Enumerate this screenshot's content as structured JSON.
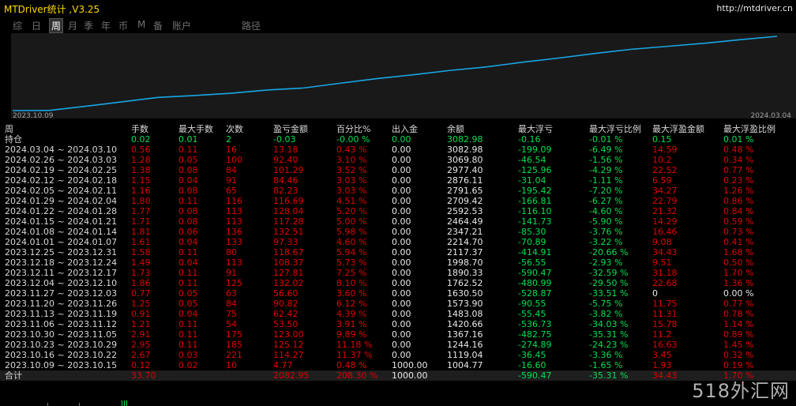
{
  "app": {
    "title": "MTDriver统计 ,V3.25",
    "url": "http://mtdriver.cn"
  },
  "tabs": [
    {
      "label": "综",
      "active": false
    },
    {
      "label": "日",
      "active": false
    },
    {
      "label": "周",
      "active": true
    },
    {
      "label": "月",
      "active": false
    },
    {
      "label": "季",
      "active": false
    },
    {
      "label": "年",
      "active": false
    },
    {
      "label": "币",
      "active": false
    },
    {
      "label": "M",
      "active": false
    },
    {
      "label": "备",
      "active": false
    },
    {
      "label": "账户",
      "active": false
    },
    {
      "label": "路径",
      "active": false
    }
  ],
  "chart_data": {
    "type": "line",
    "x_labels": [
      "2023.10.09",
      "2024.03.04"
    ],
    "x": [
      "2023.10.09",
      "2023.10.16",
      "2023.10.23",
      "2023.10.30",
      "2023.11.06",
      "2023.11.13",
      "2023.11.20",
      "2023.11.27",
      "2023.12.04",
      "2023.12.11",
      "2023.12.18",
      "2023.12.25",
      "2024.01.01",
      "2024.01.08",
      "2024.01.15",
      "2024.01.22",
      "2024.01.29",
      "2024.02.05",
      "2024.02.12",
      "2024.02.19",
      "2024.02.26",
      "2024.03.04"
    ],
    "values": [
      0,
      4.77,
      119.04,
      244.16,
      367.16,
      420.66,
      483.08,
      573.9,
      630.5,
      762.52,
      890.33,
      998.7,
      1117.37,
      1214.7,
      1347.21,
      1464.29,
      1592.53,
      1709.21,
      1791.65,
      1876.21,
      1977.4,
      2069.8
    ],
    "color": "#19a6e6"
  },
  "table": {
    "headers": [
      "周",
      "手数",
      "最大手数",
      "次数",
      "盈亏金额",
      "百分比%",
      "出入金",
      "余额",
      "最大浮亏",
      "最大浮亏比例",
      "最大浮盈金额",
      "最大浮盈比例"
    ],
    "holding": {
      "label": "持仓",
      "lots": "0.02",
      "max_lots": "0.01",
      "count": "2",
      "pnl": "-0.03",
      "pct": "-0.00 %",
      "io": "0.00",
      "balance": "3082.98",
      "max_dd": "-0.16",
      "max_dd_pct": "-0.01 %",
      "max_fp": "0.15",
      "max_fp_pct": "0.01 %"
    },
    "rows": [
      {
        "label": "2024.03.04 ~ 2024.03.10",
        "lots": "0.56",
        "max_lots": "0.11",
        "count": "16",
        "pnl": "13.18",
        "pct": "0.43 %",
        "io": "0.00",
        "balance": "3082.98",
        "max_dd": "-199.09",
        "max_dd_pct": "-6.49 %",
        "max_fp": "14.59",
        "max_fp_pct": "0.48 %"
      },
      {
        "label": "2024.02.26 ~ 2024.03.03",
        "lots": "1.28",
        "max_lots": "0.05",
        "count": "100",
        "pnl": "92.40",
        "pct": "3.10 %",
        "io": "0.00",
        "balance": "3069.80",
        "max_dd": "-46.54",
        "max_dd_pct": "-1.56 %",
        "max_fp": "10.2",
        "max_fp_pct": "0.34 %"
      },
      {
        "label": "2024.02.19 ~ 2024.02.25",
        "lots": "1.38",
        "max_lots": "0.08",
        "count": "84",
        "pnl": "101.29",
        "pct": "3.52 %",
        "io": "0.00",
        "balance": "2977.40",
        "max_dd": "-125.96",
        "max_dd_pct": "-4.29 %",
        "max_fp": "22.52",
        "max_fp_pct": "0.77 %"
      },
      {
        "label": "2024.02.12 ~ 2024.02.18",
        "lots": "1.15",
        "max_lots": "0.04",
        "count": "91",
        "pnl": "84.46",
        "pct": "3.03 %",
        "io": "0.00",
        "balance": "2876.11",
        "max_dd": "-31.04",
        "max_dd_pct": "-1.11 %",
        "max_fp": "6.59",
        "max_fp_pct": "0.23 %"
      },
      {
        "label": "2024.02.05 ~ 2024.02.11",
        "lots": "1.16",
        "max_lots": "0.08",
        "count": "65",
        "pnl": "82.23",
        "pct": "3.03 %",
        "io": "0.00",
        "balance": "2791.65",
        "max_dd": "-195.42",
        "max_dd_pct": "-7.20 %",
        "max_fp": "34.27",
        "max_fp_pct": "1.26 %"
      },
      {
        "label": "2024.01.29 ~ 2024.02.04",
        "lots": "1.80",
        "max_lots": "0.11",
        "count": "116",
        "pnl": "116.69",
        "pct": "4.51 %",
        "io": "0.00",
        "balance": "2709.42",
        "max_dd": "-166.81",
        "max_dd_pct": "-6.27 %",
        "max_fp": "22.79",
        "max_fp_pct": "0.86 %"
      },
      {
        "label": "2024.01.22 ~ 2024.01.28",
        "lots": "1.77",
        "max_lots": "0.08",
        "count": "113",
        "pnl": "128.04",
        "pct": "5.20 %",
        "io": "0.00",
        "balance": "2592.53",
        "max_dd": "-116.10",
        "max_dd_pct": "-4.60 %",
        "max_fp": "21.32",
        "max_fp_pct": "0.84 %"
      },
      {
        "label": "2024.01.15 ~ 2024.01.21",
        "lots": "1.71",
        "max_lots": "0.08",
        "count": "113",
        "pnl": "117.28",
        "pct": "5.00 %",
        "io": "0.00",
        "balance": "2464.49",
        "max_dd": "-141.73",
        "max_dd_pct": "-5.90 %",
        "max_fp": "14.29",
        "max_fp_pct": "0.59 %"
      },
      {
        "label": "2024.01.08 ~ 2024.01.14",
        "lots": "1.81",
        "max_lots": "0.06",
        "count": "136",
        "pnl": "132.51",
        "pct": "5.98 %",
        "io": "0.00",
        "balance": "2347.21",
        "max_dd": "-85.30",
        "max_dd_pct": "-3.76 %",
        "max_fp": "16.46",
        "max_fp_pct": "0.73 %"
      },
      {
        "label": "2024.01.01 ~ 2024.01.07",
        "lots": "1.61",
        "max_lots": "0.04",
        "count": "133",
        "pnl": "97.33",
        "pct": "4.60 %",
        "io": "0.00",
        "balance": "2214.70",
        "max_dd": "-70.89",
        "max_dd_pct": "-3.22 %",
        "max_fp": "9.08",
        "max_fp_pct": "0.41 %"
      },
      {
        "label": "2023.12.25 ~ 2023.12.31",
        "lots": "1.58",
        "max_lots": "0.11",
        "count": "80",
        "pnl": "118.67",
        "pct": "5.94 %",
        "io": "0.00",
        "balance": "2117.37",
        "max_dd": "-414.91",
        "max_dd_pct": "-20.66 %",
        "max_fp": "34.43",
        "max_fp_pct": "1.68 %"
      },
      {
        "label": "2023.12.18 ~ 2023.12.24",
        "lots": "1.49",
        "max_lots": "0.04",
        "count": "113",
        "pnl": "108.37",
        "pct": "5.73 %",
        "io": "0.00",
        "balance": "1998.70",
        "max_dd": "-56.55",
        "max_dd_pct": "-2.93 %",
        "max_fp": "9.51",
        "max_fp_pct": "0.50 %"
      },
      {
        "label": "2023.12.11 ~ 2023.12.17",
        "lots": "1.73",
        "max_lots": "0.11",
        "count": "91",
        "pnl": "127.81",
        "pct": "7.25 %",
        "io": "0.00",
        "balance": "1890.33",
        "max_dd": "-590.47",
        "max_dd_pct": "-32.59 %",
        "max_fp": "31.18",
        "max_fp_pct": "1.70 %"
      },
      {
        "label": "2023.12.04 ~ 2023.12.10",
        "lots": "1.86",
        "max_lots": "0.11",
        "count": "125",
        "pnl": "132.02",
        "pct": "8.10 %",
        "io": "0.00",
        "balance": "1762.52",
        "max_dd": "-480.99",
        "max_dd_pct": "-29.50 %",
        "max_fp": "22.68",
        "max_fp_pct": "1.36 %"
      },
      {
        "label": "2023.11.27 ~ 2023.12.03",
        "lots": "0.77",
        "max_lots": "0.05",
        "count": "63",
        "pnl": "56.60",
        "pct": "3.60 %",
        "io": "0.00",
        "balance": "1630.50",
        "max_dd": "-528.87",
        "max_dd_pct": "-33.51 %",
        "max_fp": "0",
        "max_fp_pct": "0.00 %"
      },
      {
        "label": "2023.11.20 ~ 2023.11.26",
        "lots": "1.25",
        "max_lots": "0.05",
        "count": "84",
        "pnl": "90.82",
        "pct": "6.12 %",
        "io": "0.00",
        "balance": "1573.90",
        "max_dd": "-90.55",
        "max_dd_pct": "-5.75 %",
        "max_fp": "11.75",
        "max_fp_pct": "0.77 %"
      },
      {
        "label": "2023.11.13 ~ 2023.11.19",
        "lots": "0.91",
        "max_lots": "0.04",
        "count": "75",
        "pnl": "62.42",
        "pct": "4.39 %",
        "io": "0.00",
        "balance": "1483.08",
        "max_dd": "-55.45",
        "max_dd_pct": "-3.82 %",
        "max_fp": "11.31",
        "max_fp_pct": "0.78 %"
      },
      {
        "label": "2023.11.06 ~ 2023.11.12",
        "lots": "1.21",
        "max_lots": "0.11",
        "count": "54",
        "pnl": "53.50",
        "pct": "3.91 %",
        "io": "0.00",
        "balance": "1420.66",
        "max_dd": "-536.73",
        "max_dd_pct": "-34.03 %",
        "max_fp": "15.78",
        "max_fp_pct": "1.14 %"
      },
      {
        "label": "2023.10.30 ~ 2023.11.05",
        "lots": "2.91",
        "max_lots": "0.11",
        "count": "175",
        "pnl": "123.00",
        "pct": "9.89 %",
        "io": "0.00",
        "balance": "1367.16",
        "max_dd": "-482.75",
        "max_dd_pct": "-35.31 %",
        "max_fp": "11.2",
        "max_fp_pct": "0.89 %"
      },
      {
        "label": "2023.10.23 ~ 2023.10.29",
        "lots": "2.95",
        "max_lots": "0.11",
        "count": "185",
        "pnl": "125.12",
        "pct": "11.18 %",
        "io": "0.00",
        "balance": "1244.16",
        "max_dd": "-274.89",
        "max_dd_pct": "-24.23 %",
        "max_fp": "16.63",
        "max_fp_pct": "1.45 %"
      },
      {
        "label": "2023.10.16 ~ 2023.10.22",
        "lots": "2.67",
        "max_lots": "0.03",
        "count": "221",
        "pnl": "114.27",
        "pct": "11.37 %",
        "io": "0.00",
        "balance": "1119.04",
        "max_dd": "-36.45",
        "max_dd_pct": "-3.36 %",
        "max_fp": "3.45",
        "max_fp_pct": "0.32 %"
      },
      {
        "label": "2023.10.09 ~ 2023.10.15",
        "lots": "0.12",
        "max_lots": "0.02",
        "count": "10",
        "pnl": "4.77",
        "pct": "0.48 %",
        "io": "1000.00",
        "balance": "1004.77",
        "max_dd": "-16.60",
        "max_dd_pct": "-1.65 %",
        "max_fp": "1.93",
        "max_fp_pct": "0.19 %"
      }
    ],
    "total": {
      "label": "合计",
      "lots": "33.70",
      "max_lots": "",
      "count": "",
      "pnl": "2082.95",
      "pct": "208.30 %",
      "io": "1000.00",
      "balance": "",
      "max_dd": "-590.47",
      "max_dd_pct": "-35.31 %",
      "max_fp": "34.43",
      "max_fp_pct": "1.70 %"
    }
  },
  "watermark": "518外汇网",
  "colors": {
    "profit": "#e00000",
    "loss": "#00e050",
    "line": "#19a6e6"
  }
}
